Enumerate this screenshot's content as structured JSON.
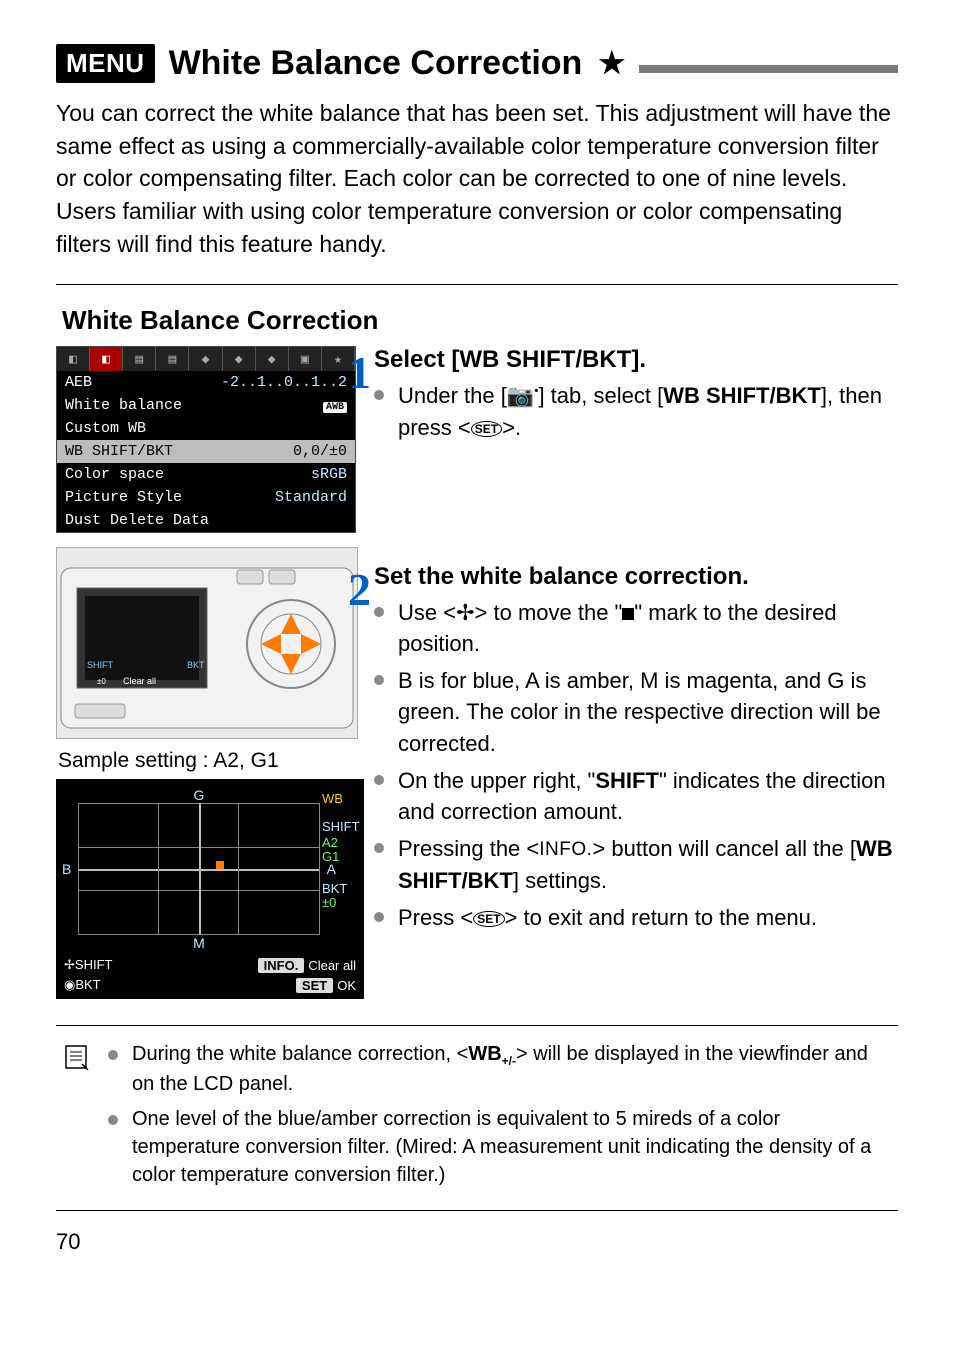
{
  "header": {
    "menu_badge": "MENU",
    "title": "White Balance Correction",
    "star": "★"
  },
  "intro": {
    "p1": "You can correct the white balance that has been set. This adjustment will have the same effect as using a commercially-available color temperature conversion filter or color compensating filter. Each color can be corrected to one of nine levels.",
    "p2": "Users familiar with using color temperature conversion or color compensating filters will find this feature handy."
  },
  "sub_heading": "White Balance Correction",
  "menu_shot": {
    "rows": [
      {
        "label": "AEB",
        "value": "-2..1..0..1..2"
      },
      {
        "label": "White balance",
        "value": "AWB"
      },
      {
        "label": "Custom WB",
        "value": ""
      },
      {
        "label": "WB SHIFT/BKT",
        "value": "0,0/±0",
        "hl": true
      },
      {
        "label": "Color space",
        "value": "sRGB"
      },
      {
        "label": "Picture Style",
        "value": "Standard"
      },
      {
        "label": "Dust Delete Data",
        "value": ""
      }
    ]
  },
  "sample_label": "Sample setting : A2, G1",
  "wbgrid": {
    "top": "G",
    "bottom": "M",
    "left": "B",
    "right": "A",
    "wb_label": "WB",
    "shift_label": "SHIFT",
    "shift_a": "A2",
    "shift_g": "G1",
    "bkt_label": "BKT",
    "bkt_val": "±0",
    "footer_left1": "SHIFT",
    "footer_left2": "BKT",
    "footer_info": "INFO.",
    "footer_clear": "Clear all",
    "footer_set": "SET",
    "footer_ok": "OK"
  },
  "steps": {
    "s1": {
      "num": "1",
      "title": "Select [WB SHIFT/BKT].",
      "b1_a": "Under the [",
      "b1_b": "] tab, select [",
      "b1_bold": "WB SHIFT/BKT",
      "b1_c": "], then press <",
      "b1_d": ">."
    },
    "s2": {
      "num": "2",
      "title": "Set the white balance correction.",
      "b1_a": "Use <",
      "b1_b": "> to move the \"",
      "b1_c": "\" mark to the desired position.",
      "b2": "B is for blue, A is amber, M is magenta, and G is green. The color in the respective direction will be corrected.",
      "b3_a": "On the upper right, \"",
      "b3_bold": "SHIFT",
      "b3_b": "\" indicates the direction and correction amount.",
      "b4_a": "Pressing the <",
      "b4_info": "INFO.",
      "b4_b": "> button will cancel all the [",
      "b4_bold": "WB SHIFT/BKT",
      "b4_c": "] settings.",
      "b5_a": "Press <",
      "b5_b": "> to exit and return to the menu."
    }
  },
  "notes": {
    "n1_a": "During the white balance correction, <",
    "n1_b": "> will be displayed in the viewfinder and on the LCD panel.",
    "n2": "One level of the blue/amber correction is equivalent to 5 mireds of a color temperature conversion filter. (Mired: A measurement unit indicating the density of a color temperature conversion filter.)"
  },
  "page_number": "70"
}
